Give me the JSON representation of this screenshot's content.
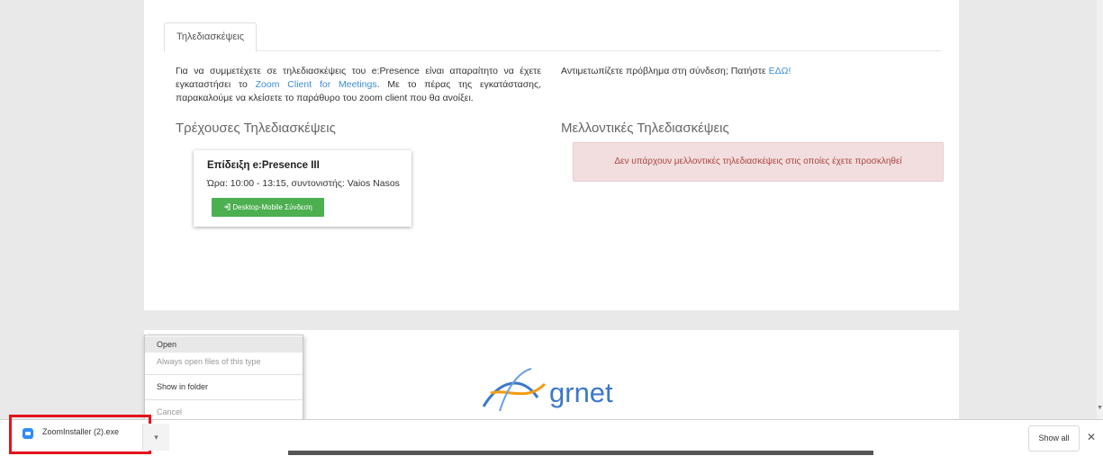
{
  "tabs": [
    {
      "label": "Τηλεδιασκέψεις"
    }
  ],
  "intro": {
    "text_before": "Για να συμμετέχετε σε τηλεδιασκέψεις του e:Presence είναι απαραίτητο να έχετε εγκαταστήσει το ",
    "link": "Zoom Client for Meetings",
    "text_after": ". Με το πέρας της εγκατάστασης, παρακαλούμε να κλείσετε το παράθυρο του zoom client που θα ανοίξει."
  },
  "problem": {
    "text": "Αντιμετωπίζετε πρόβλημα στη σύνδεση; Πατήστε ",
    "link": "ΕΔΩ!"
  },
  "current_section": {
    "title": "Τρέχουσες Τηλεδιασκέψεις"
  },
  "future_section": {
    "title": "Μελλοντικές Τηλεδιασκέψεις"
  },
  "meeting": {
    "name": "Επίδειξη e:Presence III",
    "time": "Ώρα: 10:00 - 13:15, συντονιστής: Vaios Nasos",
    "join_icon": "sign-in-icon",
    "join_label": "Desktop-Mobile Σύνδεση"
  },
  "alert": {
    "text": "Δεν υπάρχουν μελλοντικές τηλεδιασκέψεις στις οποίες έχετε προσκληθεί"
  },
  "footer": {
    "logo_text": "grnet"
  },
  "context_menu": {
    "items": [
      {
        "label": "Open"
      },
      {
        "label": "Always open files of this type"
      },
      {
        "label": "Show in folder"
      },
      {
        "label": "Cancel"
      }
    ]
  },
  "download_bar": {
    "file_icon": "zoom-file-icon",
    "file_name": "ZoomInstaller (2).exe",
    "chevron_icon": "chevron-down-icon",
    "show_all_label": "Show all",
    "close_icon": "close-icon"
  },
  "colors": {
    "link": "#3a8fd8",
    "join_button": "#4caf50",
    "alert_bg": "#f2dede",
    "alert_text": "#a94442",
    "highlight_border": "#e3141c"
  }
}
